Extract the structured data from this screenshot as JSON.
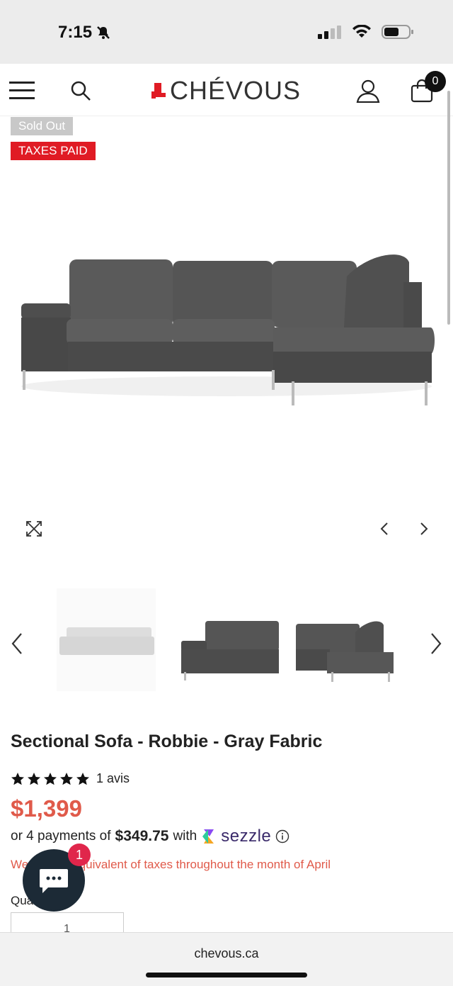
{
  "status": {
    "time": "7:15"
  },
  "header": {
    "logo": "CHÉVOUS",
    "cart_count": "0"
  },
  "badges": {
    "sold_out": "Sold Out",
    "taxes": "TAXES PAID"
  },
  "product": {
    "title": "Sectional Sofa - Robbie - Gray Fabric",
    "rating": 5,
    "reviews": "1 avis",
    "price": "$1,399",
    "installment_prefix": "or 4 payments of",
    "installment_amount": "$349.75",
    "installment_suffix": "with",
    "installment_brand": "sezzle",
    "promo_visible": "We",
    "promo_text": "equivalent of taxes throughout the month of April",
    "quantity_label": "Qua",
    "quantity": "1"
  },
  "chat": {
    "badge": "1"
  },
  "browser": {
    "url": "chevous.ca"
  },
  "colors": {
    "accent": "#e05a4a",
    "badge_red": "#e01b24",
    "sofa": "#555555"
  }
}
